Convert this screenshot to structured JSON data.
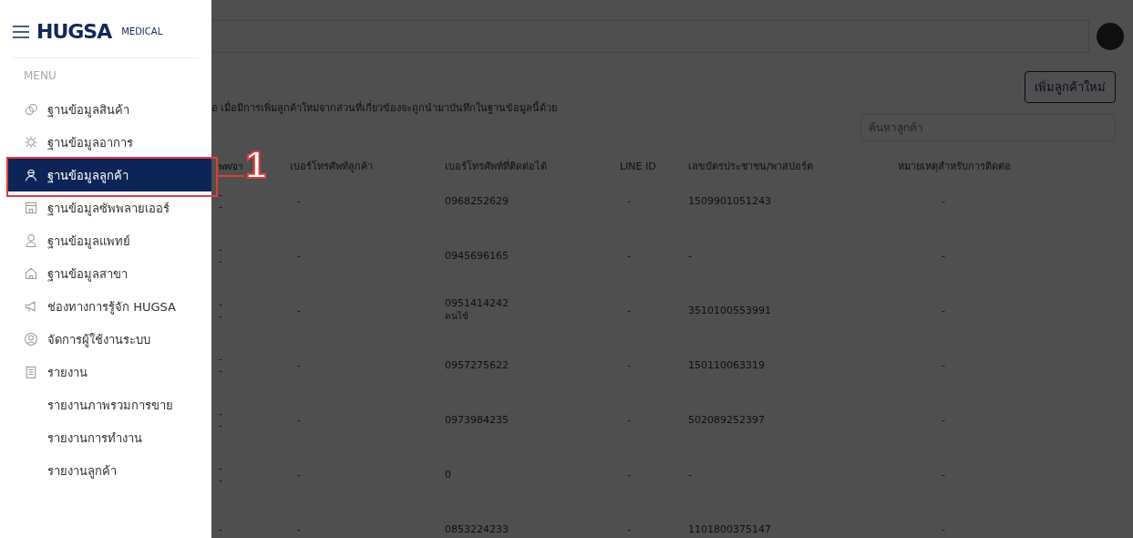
{
  "sidebar": {
    "brand": {
      "name": "HUGSA",
      "suffix": "MEDICAL"
    },
    "section_label": "MENU",
    "items": [
      {
        "label": "ฐานข้อมูลสินค้า",
        "selected": false
      },
      {
        "label": "ฐานข้อมูลอาการ",
        "selected": false
      },
      {
        "label": "ฐานข้อมูลลูกค้า",
        "selected": true
      },
      {
        "label": "ฐานข้อมูลซัพพลายเออร์",
        "selected": false
      },
      {
        "label": "ฐานข้อมูลแพทย์",
        "selected": false
      },
      {
        "label": "ฐานข้อมูลสาขา",
        "selected": false
      },
      {
        "label": "ช่องทางการรู้จัก HUGSA",
        "selected": false
      },
      {
        "label": "จัดการผู้ใช้งานระบบ",
        "selected": false
      },
      {
        "label": "รายงาน",
        "selected": false,
        "children": [
          {
            "label": "รายงานภาพรวมการขาย",
            "selected": false
          },
          {
            "label": "รายงานการทำงาน",
            "selected": false
          },
          {
            "label": "รายงานลูกค้า",
            "selected": false
          }
        ]
      }
    ]
  },
  "annotation": {
    "label": "1"
  },
  "backdrop": {
    "dimmed": true
  },
  "main": {
    "description": "อ เมื่อมีการเพิ่มลูกค้าใหม่จากส่วนที่เกี่ยวข้องจะถูกนำมาบันทึกในฐานข้อมูลนี้ด้วย",
    "add_button": "เพิ่มลูกค้าใหม่",
    "search": {
      "placeholder": "ค้นหาลูกค้า"
    },
    "table": {
      "columns": [
        "พท/อา",
        "เบอร์โทรศัพท์ลูกค้า",
        "เบอร์โทรศัพท์ที่ติดต่อได้",
        "LINE ID",
        "เลขบัตรประชาชน/พาสปอร์ต",
        "หมายเหตุสำหรับการติดต่อ"
      ],
      "rows": [
        {
          "column_1": [
            "-",
            "-"
          ],
          "customer_phone": "-",
          "contact_phone": [
            "0968252629"
          ],
          "line_id": "-",
          "id_number": "1509901051243",
          "note": "-"
        },
        {
          "column_1": [
            "-",
            "-"
          ],
          "customer_phone": "-",
          "contact_phone": [
            "0945696165"
          ],
          "line_id": "-",
          "id_number": "-",
          "note": "-"
        },
        {
          "column_1": [
            "-",
            "-"
          ],
          "customer_phone": "-",
          "contact_phone": [
            "0951414242",
            "คนไข้"
          ],
          "line_id": "-",
          "id_number": "3510100553991",
          "note": "-"
        },
        {
          "column_1": [
            "-",
            "-"
          ],
          "customer_phone": "-",
          "contact_phone": [
            "0957275622"
          ],
          "line_id": "-",
          "id_number": "150110063319",
          "note": "-"
        },
        {
          "column_1": [
            "-",
            "-"
          ],
          "customer_phone": "-",
          "contact_phone": [
            "0973984235"
          ],
          "line_id": "-",
          "id_number": "502089252397",
          "note": "-"
        },
        {
          "column_1": [
            "-",
            "-"
          ],
          "customer_phone": "-",
          "contact_phone": [
            "0"
          ],
          "line_id": "-",
          "id_number": "-",
          "note": "-"
        },
        {
          "column_1": [
            "-"
          ],
          "customer_phone": "-",
          "contact_phone": [
            "0853224233"
          ],
          "line_id": "-",
          "id_number": "1101800375147",
          "note": "-"
        }
      ]
    }
  }
}
